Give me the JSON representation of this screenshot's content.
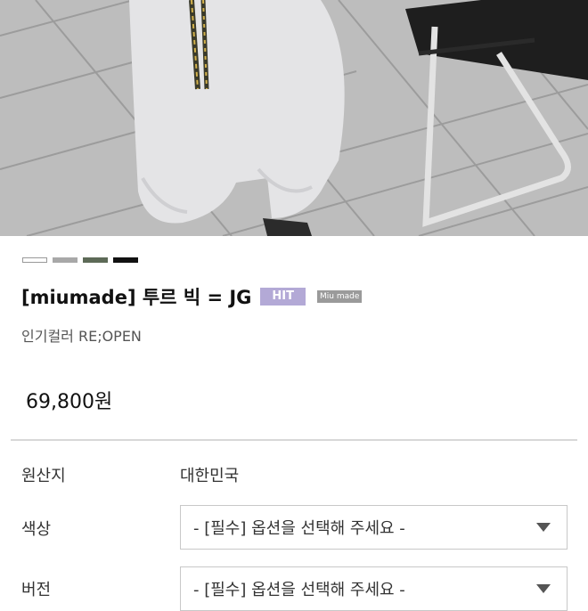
{
  "product": {
    "color_swatches": [
      {
        "name": "white",
        "color": "#ffffff"
      },
      {
        "name": "gray",
        "color": "#a8a8a8"
      },
      {
        "name": "dark-green",
        "color": "#5d6a57"
      },
      {
        "name": "black",
        "color": "#111111"
      }
    ],
    "title": "[miumade] 투르 빅 = JG",
    "badge_hit": "HIT",
    "badge_brand": "Miu made",
    "subtitle": "인기컬러 RE;OPEN",
    "price": "69,800원"
  },
  "details": {
    "origin_label": "원산지",
    "origin_value": "대한민국",
    "color_label": "색상",
    "color_select": "- [필수] 옵션을 선택해 주세요 -",
    "size_label": "버전",
    "size_select": "- [필수] 옵션을 선택해 주세요 -"
  },
  "colors": {
    "badge_hit_bg": "#b3a9d6",
    "badge_brand_bg": "#9a9a9a"
  }
}
